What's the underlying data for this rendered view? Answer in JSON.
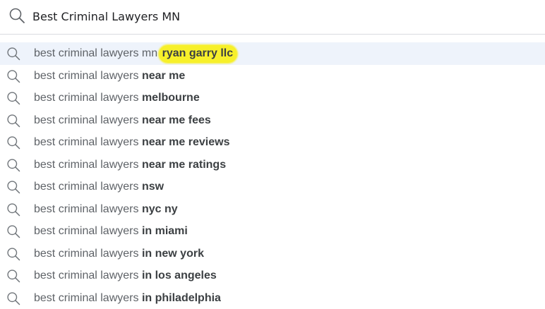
{
  "search": {
    "query": "Best Criminal Lawyers MN",
    "icon": "search-icon"
  },
  "suggestions": [
    {
      "prefix": "best criminal lawyers mn",
      "bold": "ryan garry llc",
      "highlighted": true
    },
    {
      "prefix": "best criminal lawyers",
      "bold": "near me"
    },
    {
      "prefix": "best criminal lawyers",
      "bold": "melbourne"
    },
    {
      "prefix": "best criminal lawyers",
      "bold": "near me fees"
    },
    {
      "prefix": "best criminal lawyers",
      "bold": "near me reviews"
    },
    {
      "prefix": "best criminal lawyers",
      "bold": "near me ratings"
    },
    {
      "prefix": "best criminal lawyers",
      "bold": "nsw"
    },
    {
      "prefix": "best criminal lawyers",
      "bold": "nyc ny"
    },
    {
      "prefix": "best criminal lawyers",
      "bold": "in miami"
    },
    {
      "prefix": "best criminal lawyers",
      "bold": "in new york"
    },
    {
      "prefix": "best criminal lawyers",
      "bold": "in los angeles"
    },
    {
      "prefix": "best criminal lawyers",
      "bold": "in philadelphia"
    }
  ],
  "colors": {
    "highlight": "#f7f02a",
    "active_row": "#eef3fb"
  }
}
